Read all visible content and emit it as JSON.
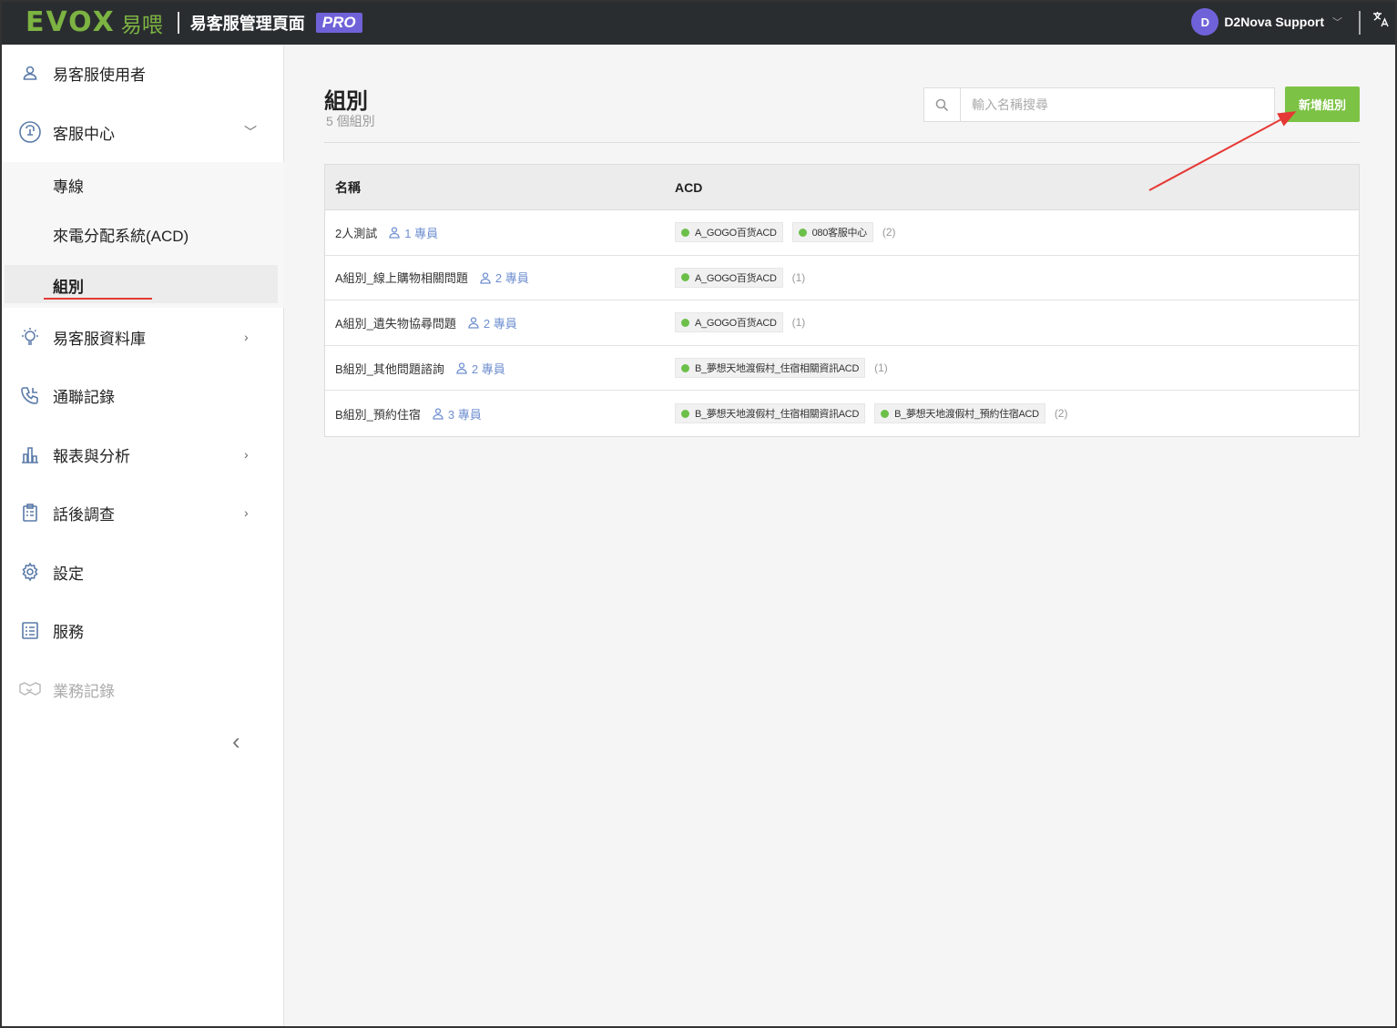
{
  "header": {
    "logo_text": "EVOX",
    "logo_cn": "易喂",
    "app_title": "易客服管理頁面",
    "pro_badge": "PRO",
    "user": {
      "initial": "D",
      "name": "D2Nova Support"
    },
    "lang_icon": "translate-icon"
  },
  "sidebar": {
    "items": [
      {
        "label": "易客服使用者",
        "icon": "user-icon"
      },
      {
        "label": "客服中心",
        "icon": "headset-icon"
      },
      {
        "label": "易客服資料庫",
        "icon": "lightbulb-icon"
      },
      {
        "label": "通聯記錄",
        "icon": "phone-icon"
      },
      {
        "label": "報表與分析",
        "icon": "bar-chart-icon"
      },
      {
        "label": "話後調查",
        "icon": "clipboard-icon"
      },
      {
        "label": "設定",
        "icon": "gear-icon"
      },
      {
        "label": "服務",
        "icon": "list-icon"
      },
      {
        "label": "業務記錄",
        "icon": "handshake-icon"
      }
    ],
    "sub_items": [
      {
        "label": "專線"
      },
      {
        "label": "來電分配系統(ACD)"
      },
      {
        "label": "組別"
      }
    ]
  },
  "main": {
    "title": "組別",
    "subtitle": "5 個組別",
    "search_placeholder": "輸入名稱搜尋",
    "add_button": "新增組別",
    "table": {
      "headers": {
        "name": "名稱",
        "acd": "ACD"
      },
      "rows": [
        {
          "name": "2人測試",
          "members": "1 專員",
          "acds": [
            "A_GOGO百货ACD",
            "080客服中心"
          ],
          "count": "(2)"
        },
        {
          "name": "A組別_線上購物相關問題",
          "members": "2 專員",
          "acds": [
            "A_GOGO百货ACD"
          ],
          "count": "(1)"
        },
        {
          "name": "A組別_遺失物協尋問題",
          "members": "2 專員",
          "acds": [
            "A_GOGO百货ACD"
          ],
          "count": "(1)"
        },
        {
          "name": "B組別_其他問題諮詢",
          "members": "2 專員",
          "acds": [
            "B_夢想天地渡假村_住宿相關資訊ACD"
          ],
          "count": "(1)"
        },
        {
          "name": "B組別_預約住宿",
          "members": "3 專員",
          "acds": [
            "B_夢想天地渡假村_住宿相關資訊ACD",
            "B_夢想天地渡假村_預約住宿ACD"
          ],
          "count": "(2)"
        }
      ]
    }
  },
  "colors": {
    "accent_green": "#7cc244",
    "pro_purple": "#6f62d9",
    "annotation_red": "#e53935"
  }
}
